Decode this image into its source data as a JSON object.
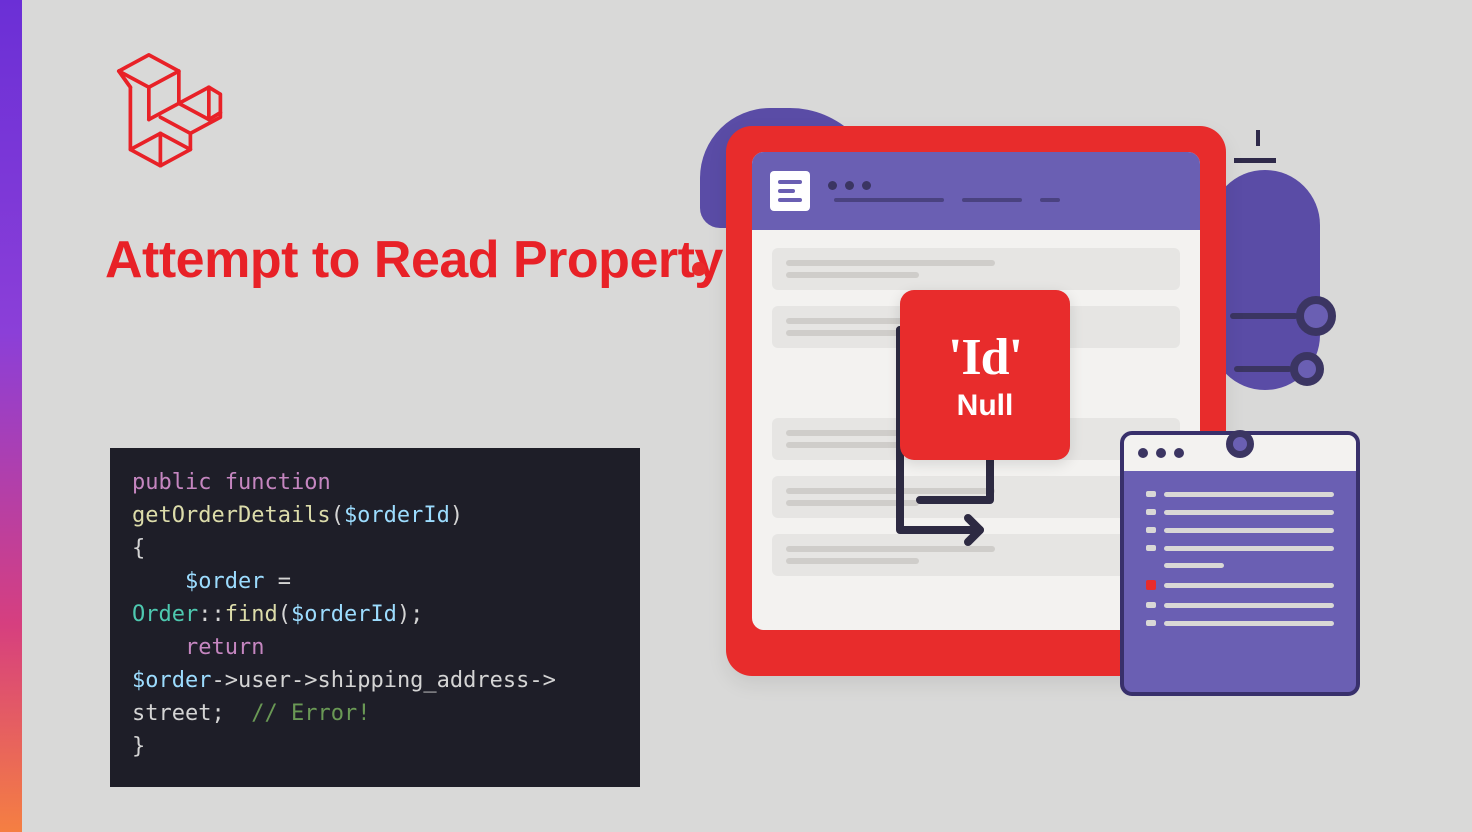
{
  "title": "Attempt to Read Property 'id' on Null",
  "code": {
    "raw": "public function\ngetOrderDetails($orderId)\n{\n    $order =\nOrder::find($orderId);\n    return\n$order->user->shipping_address->\nstreet;  // Error!\n}",
    "tokens": [
      [
        "keyword",
        "public"
      ],
      [
        "space",
        " "
      ],
      [
        "keyword",
        "function"
      ],
      [
        "newline",
        ""
      ],
      [
        "function-name",
        "getOrderDetails"
      ],
      [
        "punct",
        "("
      ],
      [
        "variable",
        "$orderId"
      ],
      [
        "punct",
        ")"
      ],
      [
        "newline",
        ""
      ],
      [
        "punct",
        "{"
      ],
      [
        "newline",
        ""
      ],
      [
        "space",
        "    "
      ],
      [
        "variable",
        "$order"
      ],
      [
        "space",
        " "
      ],
      [
        "punct",
        "="
      ],
      [
        "newline",
        ""
      ],
      [
        "classname",
        "Order"
      ],
      [
        "punct",
        "::"
      ],
      [
        "method",
        "find"
      ],
      [
        "punct",
        "("
      ],
      [
        "variable",
        "$orderId"
      ],
      [
        "punct",
        ");"
      ],
      [
        "newline",
        ""
      ],
      [
        "space",
        "    "
      ],
      [
        "keyword",
        "return"
      ],
      [
        "newline",
        ""
      ],
      [
        "variable",
        "$order"
      ],
      [
        "punct",
        "->"
      ],
      [
        "punct",
        "user"
      ],
      [
        "punct",
        "->"
      ],
      [
        "punct",
        "shipping_address"
      ],
      [
        "punct",
        "->"
      ],
      [
        "newline",
        ""
      ],
      [
        "punct",
        "street"
      ],
      [
        "punct",
        ";  "
      ],
      [
        "comment",
        "// Error!"
      ],
      [
        "newline",
        ""
      ],
      [
        "punct",
        "}"
      ]
    ]
  },
  "illustration": {
    "red_card_id": "'Id'",
    "red_card_null": "Null",
    "window_dots": "• • •"
  },
  "colors": {
    "accent_red": "#e82127",
    "purple": "#6a5fb3",
    "dark_purple": "#3b3562",
    "bg": "#d9d9d8"
  }
}
